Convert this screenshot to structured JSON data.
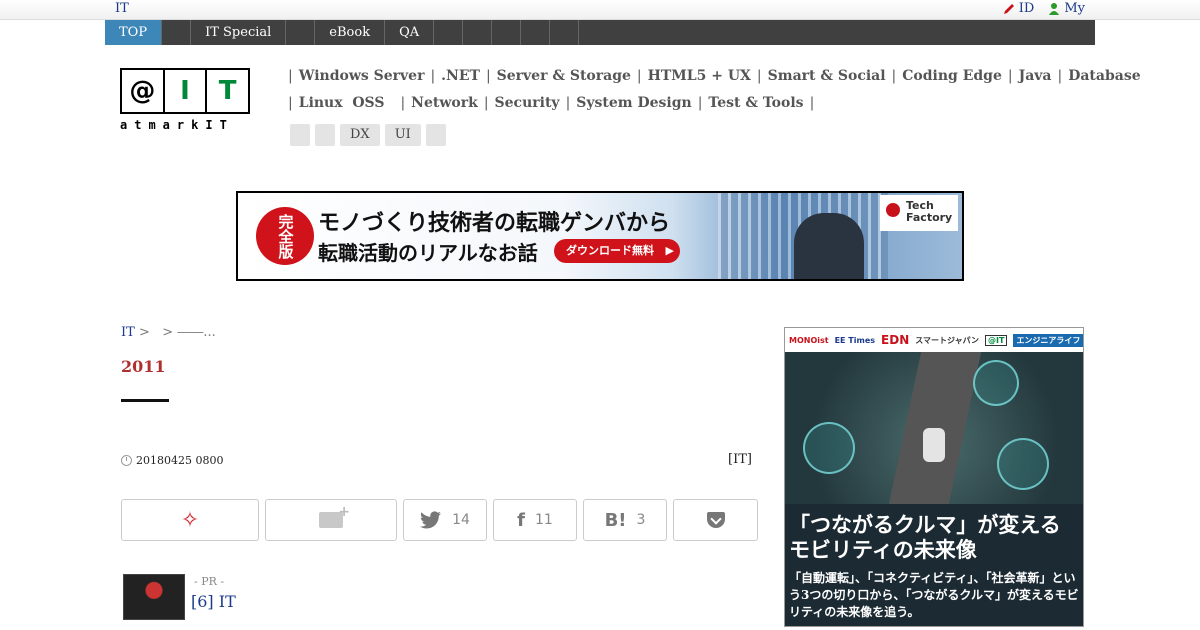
{
  "util": {
    "site": "IT",
    "id_label": "ID",
    "my_label": "My"
  },
  "nav": {
    "items": [
      "TOP",
      "",
      "IT Special",
      "",
      "eBook",
      "QA",
      "",
      "",
      "",
      "",
      ""
    ]
  },
  "logo": {
    "letters": [
      "@",
      "I",
      "T"
    ],
    "word": "atmarkIT"
  },
  "categories": {
    "row1": [
      "Windows Server",
      ".NET",
      "Server & Storage",
      "HTML5 + UX",
      "Smart & Social",
      "Coding Edge",
      "Java",
      "Database"
    ],
    "row2": [
      "Linux  OSS",
      "Network",
      "Security",
      "System Design",
      "Test & Tools"
    ],
    "tags": [
      "",
      "",
      "DX",
      "UI",
      ""
    ]
  },
  "banner": {
    "badge": "完全版",
    "line1": "モノづくり技術者の転職ゲンバから",
    "line2": "転職活動のリアルなお話",
    "button": "ダウンロード無料",
    "brand": "Tech Factory"
  },
  "breadcrumb": {
    "home": "IT",
    "sep1": ">",
    "sep2": ">",
    "current": "――..."
  },
  "article": {
    "year": "2011",
    "date": "20180425 0800",
    "source": "[IT]"
  },
  "share": {
    "twitter_count": "14",
    "facebook_count": "11",
    "hatena_count": "3"
  },
  "pr": {
    "label": "- PR -",
    "title": "[6] IT"
  },
  "ad": {
    "logos": [
      "MONOist",
      "EE Times",
      "EDN",
      "スマートジャパン",
      "@IT",
      "エンジニアライフ"
    ],
    "headline1": "「つながるクルマ」が変える",
    "headline2": "モビリティの未来像",
    "body": "「自動運転」、「コネクティビティ」、「社会革新」という3つの切り口から、「つながるクルマ」が変えるモビリティの未来像を追う。"
  }
}
